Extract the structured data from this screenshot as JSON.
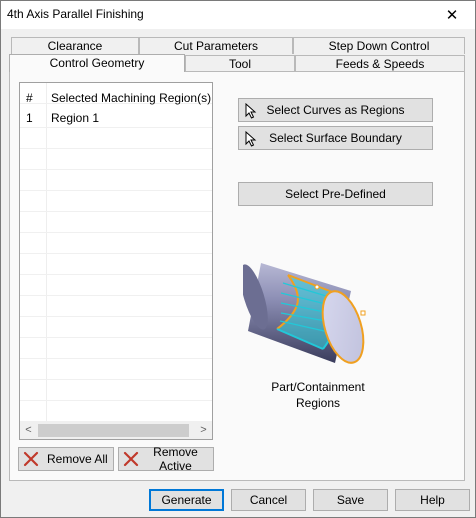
{
  "window": {
    "title": "4th Axis Parallel Finishing",
    "close_glyph": "✕"
  },
  "tabs_back": [
    "Clearance",
    "Cut Parameters",
    "Step Down Control"
  ],
  "tabs_front": [
    "Control Geometry",
    "Tool",
    "Feeds & Speeds"
  ],
  "active_tab": "Control Geometry",
  "region_list": {
    "columns": [
      "#",
      "Selected Machining Region(s)"
    ],
    "rows": [
      {
        "num": "1",
        "name": "Region 1"
      }
    ],
    "scroll_left": "<",
    "scroll_right": ">"
  },
  "buttons": {
    "select_curves": "Select Curves as Regions",
    "select_surface": "Select Surface Boundary",
    "select_predefined": "Select Pre-Defined",
    "remove_all": "Remove All",
    "remove_active": "Remove Active"
  },
  "illustration": {
    "caption_line1": "Part/Containment",
    "caption_line2": "Regions"
  },
  "footer": {
    "generate": "Generate",
    "cancel": "Cancel",
    "save": "Save",
    "help": "Help"
  },
  "colors": {
    "accent": "#0078d7",
    "region_cyan": "#22c8d8",
    "region_orange": "#f0a020"
  }
}
